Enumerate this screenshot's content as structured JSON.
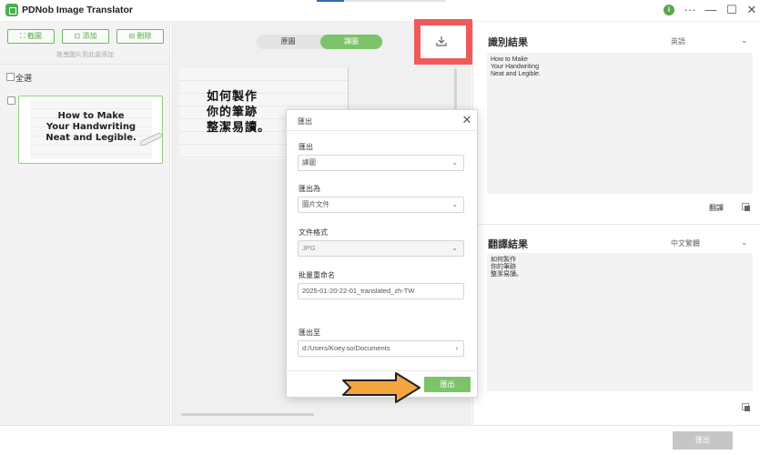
{
  "app": {
    "title": "PDNob Image Translator",
    "info_badge": "i",
    "window_controls": {
      "more": "···",
      "minimize": "—",
      "maximize": "☐",
      "close": "✕"
    }
  },
  "left_panel": {
    "buttons": [
      {
        "label": "⛶ 截圖"
      },
      {
        "label": "⊡ 添加"
      },
      {
        "label": "⊟ 刪除"
      }
    ],
    "hint": "拖曳圖片到此處添加",
    "select_all_label": "全選",
    "thumbnail_lines": [
      "How to Make",
      "Your Handwriting",
      "Neat and Legible."
    ]
  },
  "center_panel": {
    "toggle": {
      "original": "原圖",
      "translated": "譯圖"
    },
    "preview_lines": [
      "如何製作",
      "你的筆跡",
      "整潔易讀。"
    ]
  },
  "recognition": {
    "title": "識別結果",
    "language": "英語",
    "text_lines": [
      "How to Make",
      "Your Handwriting",
      "Neat and Legible."
    ],
    "translate_label": "翻譯"
  },
  "translation": {
    "title": "翻譯結果",
    "language": "中文繁體",
    "text_lines": [
      "如何製作",
      "你的筆跡",
      "整潔易讀。"
    ]
  },
  "export_dialog": {
    "title": "匯出",
    "close_icon": "✕",
    "fields": {
      "export": {
        "label": "匯出",
        "value": "譯圖"
      },
      "export_as": {
        "label": "匯出為",
        "value": "圖片文件"
      },
      "file_format": {
        "label": "文件格式",
        "value": "JPG"
      },
      "batch_rename": {
        "label": "批量重命名",
        "value": "2025-01-20-22-01_translated_zh-TW"
      },
      "export_to": {
        "label": "匯出至",
        "value": "d:/Users/Koey.so/Documents"
      }
    },
    "export_button": "匯出"
  },
  "bottom_bar": {
    "export_button": "匯出"
  },
  "colors": {
    "accent_green": "#7cc36a",
    "highlight_red": "#f05a5a",
    "arrow_orange": "#f5a540"
  },
  "icons": {
    "download": "download-icon",
    "chevron": "chevron-down-icon",
    "copy": "copy-icon",
    "close": "close-icon"
  }
}
